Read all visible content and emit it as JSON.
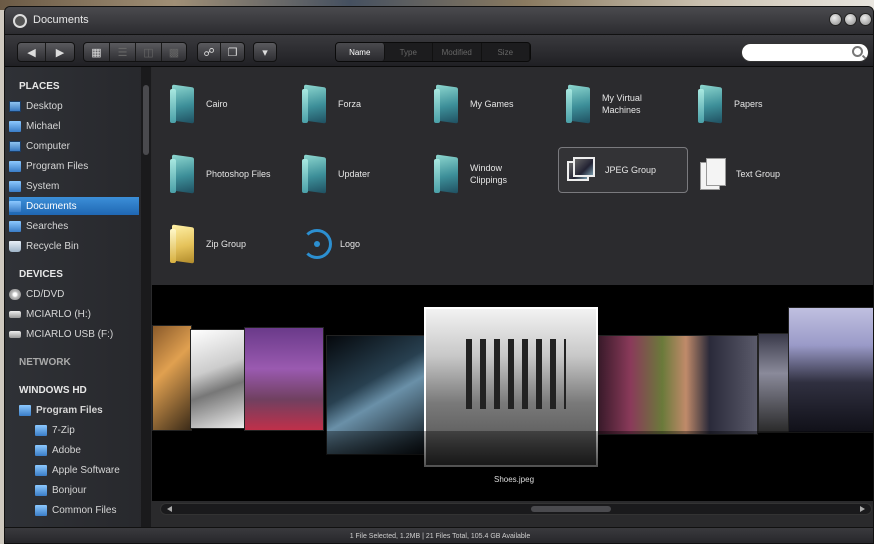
{
  "window": {
    "title": "Documents"
  },
  "toolbar": {
    "view_tabs": [
      "Name",
      "Type",
      "Modified",
      "Size"
    ]
  },
  "sidebar": {
    "places_header": "PLACES",
    "places": [
      {
        "label": "Desktop",
        "icon": "desktop-icon"
      },
      {
        "label": "Michael",
        "icon": "user-folder-icon"
      },
      {
        "label": "Computer",
        "icon": "computer-icon"
      },
      {
        "label": "Program Files",
        "icon": "folder-icon"
      },
      {
        "label": "System",
        "icon": "folder-icon"
      },
      {
        "label": "Documents",
        "icon": "documents-icon",
        "selected": true
      },
      {
        "label": "Searches",
        "icon": "search-folder-icon"
      },
      {
        "label": "Recycle Bin",
        "icon": "recycle-bin-icon"
      }
    ],
    "devices_header": "DEVICES",
    "devices": [
      {
        "label": "CD/DVD",
        "icon": "disc-icon"
      },
      {
        "label": "MCIARLO (H:)",
        "icon": "drive-icon"
      },
      {
        "label": "MCIARLO USB (F:)",
        "icon": "usb-drive-icon"
      }
    ],
    "network_header": "NETWORK",
    "windows_header": "WINDOWS HD",
    "tree": [
      {
        "label": "Program Files",
        "icon": "folder-icon"
      },
      {
        "label": "7-Zip",
        "icon": "folder-icon"
      },
      {
        "label": "Adobe",
        "icon": "folder-icon"
      },
      {
        "label": "Apple Software",
        "icon": "folder-icon"
      },
      {
        "label": "Bonjour",
        "icon": "folder-icon"
      },
      {
        "label": "Common Files",
        "icon": "folder-icon"
      }
    ]
  },
  "files": [
    {
      "name": "Cairo",
      "type": "folder"
    },
    {
      "name": "Forza",
      "type": "folder"
    },
    {
      "name": "My Games",
      "type": "folder"
    },
    {
      "name": "My Virtual Machines",
      "type": "folder"
    },
    {
      "name": "Papers",
      "type": "folder"
    },
    {
      "name": "Photoshop Files",
      "type": "folder"
    },
    {
      "name": "Updater",
      "type": "folder"
    },
    {
      "name": "Window Clippings",
      "type": "folder"
    },
    {
      "name": "JPEG Group",
      "type": "image-group",
      "selected": true
    },
    {
      "name": "Text Group",
      "type": "text-group"
    },
    {
      "name": "Zip Group",
      "type": "zip-group"
    },
    {
      "name": "Logo",
      "type": "logo"
    }
  ],
  "coverflow": {
    "caption": "Shoes.jpeg"
  },
  "status": {
    "text": "1 File Selected, 1.2MB  |  21 Files Total, 105.4 GB Available"
  },
  "colors": {
    "selection": "#2a78c8",
    "window_bg": "#2b2b2e",
    "accent_logo": "#2c8fd0"
  }
}
